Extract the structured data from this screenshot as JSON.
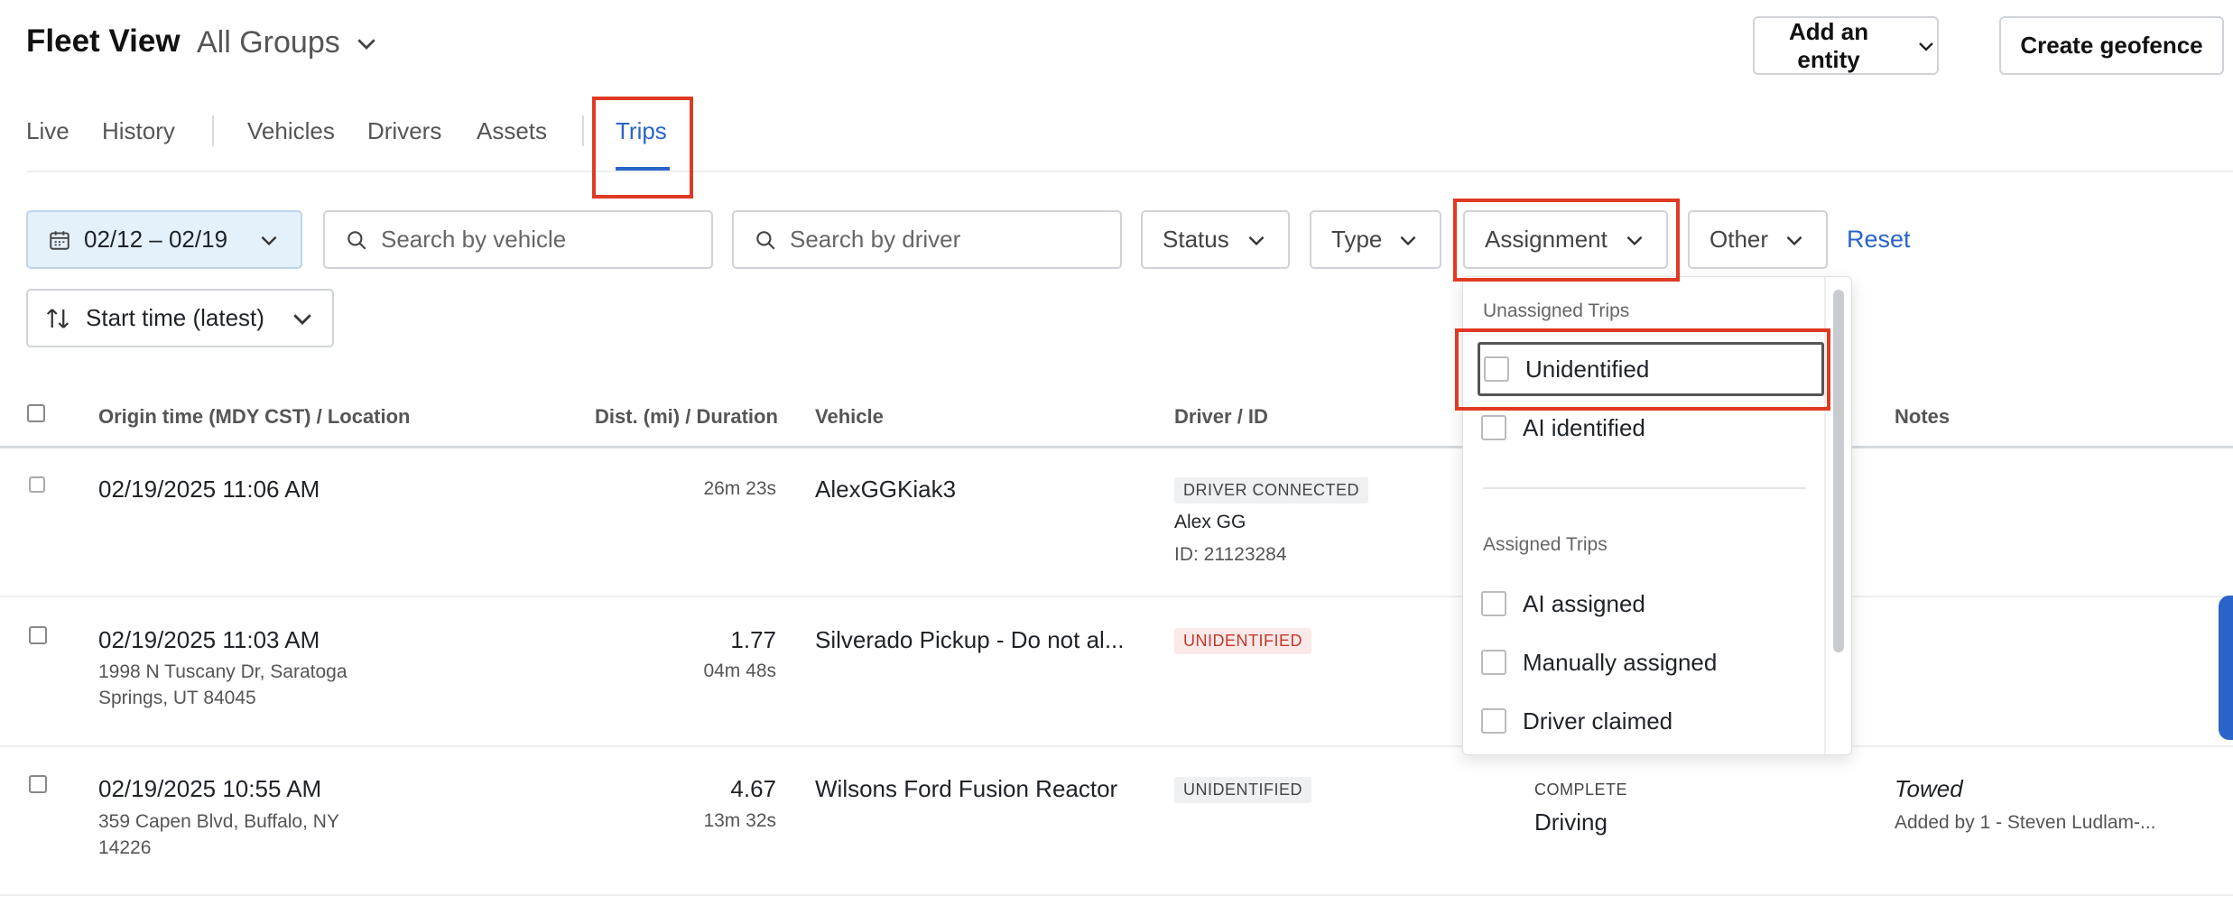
{
  "header": {
    "title": "Fleet View",
    "group_selector": "All Groups",
    "add_entity_label": "Add an entity",
    "create_geofence_label": "Create geofence"
  },
  "tabs": {
    "live": "Live",
    "history": "History",
    "vehicles": "Vehicles",
    "drivers": "Drivers",
    "assets": "Assets",
    "trips": "Trips",
    "active": "Trips"
  },
  "filters": {
    "date_range": "02/12 – 02/19",
    "vehicle_search_placeholder": "Search by vehicle",
    "driver_search_placeholder": "Search by driver",
    "status": "Status",
    "type": "Type",
    "assignment": "Assignment",
    "other": "Other",
    "reset": "Reset",
    "sort": "Start time (latest)"
  },
  "table": {
    "columns": {
      "origin": "Origin time (MDY CST) / Location",
      "distance": "Dist. (mi) / Duration",
      "vehicle": "Vehicle",
      "driver": "Driver / ID",
      "notes": "Notes"
    },
    "rows": [
      {
        "origin_time": "02/19/2025 11:06 AM",
        "location": "",
        "location_line2": "",
        "distance": "",
        "duration": "26m 23s",
        "vehicle": "AlexGGKiak3",
        "driver_badge": "DRIVER CONNECTED",
        "driver_name": "Alex GG",
        "driver_id": "ID: 21123284",
        "status": "",
        "status_detail": "",
        "note": "",
        "note_author": ""
      },
      {
        "origin_time": "02/19/2025 11:03 AM",
        "location": "1998 N Tuscany Dr, Saratoga",
        "location_line2": "Springs, UT 84045",
        "distance": "1.77",
        "duration": "04m 48s",
        "vehicle": "Silverado Pickup - Do not al...",
        "driver_badge": "UNIDENTIFIED",
        "driver_name": "",
        "driver_id": "",
        "status": "",
        "status_detail": "",
        "note": "",
        "note_author": ""
      },
      {
        "origin_time": "02/19/2025 10:55 AM",
        "location": "359 Capen Blvd, Buffalo, NY",
        "location_line2": "14226",
        "distance": "4.67",
        "duration": "13m 32s",
        "vehicle": "Wilsons Ford Fusion Reactor",
        "driver_badge": "UNIDENTIFIED",
        "driver_name": "",
        "driver_id": "",
        "status": "COMPLETE",
        "status_detail": "Driving",
        "note": "Towed",
        "note_author": "Added by 1 - Steven Ludlam-..."
      }
    ]
  },
  "assignment_dropdown": {
    "unassigned_header": "Unassigned Trips",
    "unassigned_items": [
      "Unidentified",
      "AI identified"
    ],
    "assigned_header": "Assigned Trips",
    "assigned_items": [
      "AI assigned",
      "Manually assigned",
      "Driver claimed"
    ]
  },
  "colors": {
    "accent": "#2a64c9",
    "annotation": "#e03a22",
    "unidentified_red": "#c0392b",
    "date_filter_bg": "#e4f0fa"
  }
}
